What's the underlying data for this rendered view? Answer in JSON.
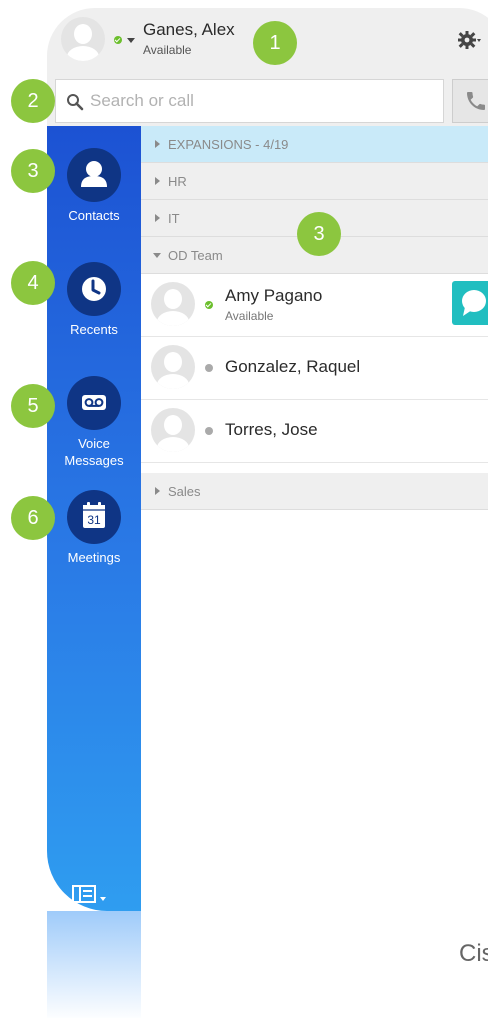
{
  "user": {
    "name": "Ganes, Alex",
    "status": "Available"
  },
  "search": {
    "placeholder": "Search or call",
    "value": ""
  },
  "nav": {
    "contacts": "Contacts",
    "recents": "Recents",
    "voice_messages_line1": "Voice",
    "voice_messages_line2": "Messages",
    "meetings": "Meetings",
    "calendar_day": "31"
  },
  "groups": [
    {
      "label": "EXPANSIONS - 4/19",
      "expanded": false,
      "selected": true
    },
    {
      "label": "HR",
      "expanded": false
    },
    {
      "label": "IT",
      "expanded": false
    },
    {
      "label": "OD Team",
      "expanded": true
    },
    {
      "label": "Sales",
      "expanded": false
    }
  ],
  "contacts": [
    {
      "name": "Amy Pagano",
      "status": "Available",
      "presence": "available"
    },
    {
      "name": "Gonzalez, Raquel",
      "status": "",
      "presence": "offline"
    },
    {
      "name": "Torres, Jose",
      "status": "",
      "presence": "offline"
    }
  ],
  "callouts": [
    "1",
    "2",
    "3",
    "3",
    "4",
    "5",
    "6"
  ],
  "brand_fragment": "Cis",
  "colors": {
    "sidebar_top": "#1c52d3",
    "sidebar_bottom": "#2f9df0",
    "callout": "#8cc63f",
    "chat": "#21bec0",
    "call": "#33b84a",
    "selected_group": "#c9eaf9"
  },
  "icons": {
    "gear": "gear-icon",
    "search": "search-icon",
    "phone": "phone-icon",
    "contacts": "person-icon",
    "recents": "clock-icon",
    "voice": "voicemail-icon",
    "meetings": "calendar-icon",
    "chat": "chat-bubble-icon",
    "layout": "layout-toggle-icon"
  }
}
